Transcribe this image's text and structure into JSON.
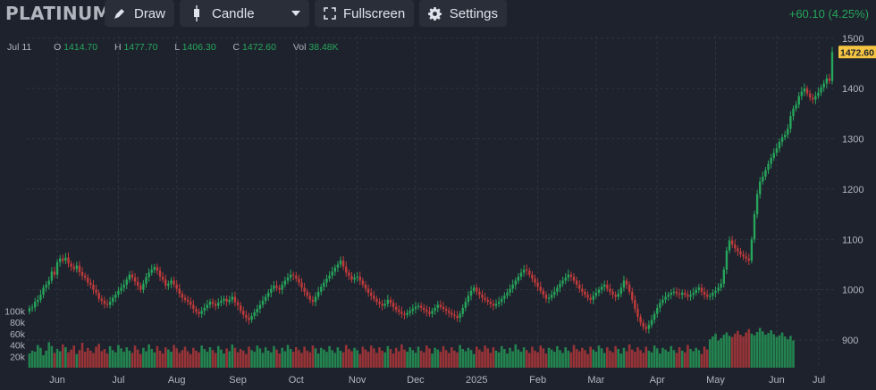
{
  "toolbar": {
    "symbol": "PLATINUM",
    "draw_label": "Draw",
    "chart_type_label": "Candle",
    "fullscreen_label": "Fullscreen",
    "settings_label": "Settings",
    "change_text": "+60.10 (4.25%)"
  },
  "ohlc": {
    "date": "Jul 11",
    "o_label": "O",
    "o": "1414.70",
    "h_label": "H",
    "h": "1477.70",
    "l_label": "L",
    "l": "1406.30",
    "c_label": "C",
    "c": "1472.60",
    "vol_label": "Vol",
    "vol": "38.48K"
  },
  "colors": {
    "up": "#26a65b",
    "down": "#c23b3b",
    "background": "#1e222d",
    "last_price_tag": "#f5c542"
  },
  "chart_data": {
    "type": "candlestick",
    "title": "",
    "xlabel": "",
    "ylabel": "",
    "ylim": [
      845,
      1505
    ],
    "y_ticks": [
      900,
      1000,
      1100,
      1200,
      1300,
      1400,
      1500
    ],
    "x_ticks": [
      "Jun",
      "Jul",
      "Aug",
      "Sep",
      "Oct",
      "Nov",
      "Dec",
      "2025",
      "Feb",
      "Mar",
      "Apr",
      "May",
      "Jun",
      "Jul"
    ],
    "volume_ticks": [
      "100k",
      "80k",
      "60k",
      "40k",
      "20k"
    ],
    "volume_ylim": [
      0,
      110000
    ],
    "last_price": "1472.60",
    "grid": true,
    "closes": [
      963,
      965,
      976,
      980,
      990,
      1004,
      1010,
      1018,
      1036,
      1030,
      1055,
      1062,
      1058,
      1064,
      1052,
      1046,
      1041,
      1048,
      1035,
      1028,
      1024,
      1014,
      1010,
      1000,
      994,
      982,
      978,
      972,
      970,
      976,
      984,
      990,
      998,
      1004,
      1010,
      1020,
      1030,
      1024,
      1016,
      1008,
      1000,
      1012,
      1025,
      1034,
      1040,
      1045,
      1038,
      1026,
      1020,
      1008,
      1012,
      1018,
      1010,
      1002,
      992,
      984,
      980,
      976,
      970,
      962,
      956,
      952,
      958,
      964,
      970,
      976,
      972,
      968,
      974,
      978,
      982,
      976,
      980,
      986,
      975,
      969,
      958,
      950,
      944,
      940,
      948,
      955,
      962,
      970,
      978,
      986,
      994,
      1002,
      1008,
      1004,
      1000,
      1010,
      1018,
      1024,
      1030,
      1028,
      1022,
      1014,
      1004,
      996,
      988,
      980,
      976,
      986,
      996,
      1006,
      1014,
      1022,
      1028,
      1036,
      1044,
      1050,
      1058,
      1046,
      1034,
      1028,
      1020,
      1024,
      1026,
      1018,
      1010,
      1002,
      994,
      988,
      982,
      976,
      972,
      968,
      972,
      980,
      974,
      966,
      960,
      956,
      952,
      950,
      954,
      958,
      962,
      966,
      968,
      964,
      960,
      956,
      952,
      958,
      964,
      970,
      966,
      962,
      958,
      954,
      950,
      948,
      944,
      952,
      964,
      976,
      988,
      998,
      1004,
      996,
      990,
      984,
      980,
      976,
      972,
      968,
      972,
      976,
      982,
      988,
      994,
      1002,
      1010,
      1018,
      1026,
      1034,
      1040,
      1038,
      1030,
      1022,
      1014,
      1006,
      998,
      990,
      982,
      984,
      990,
      996,
      1004,
      1012,
      1018,
      1024,
      1030,
      1026,
      1018,
      1010,
      1002,
      996,
      990,
      984,
      980,
      988,
      994,
      1000,
      1006,
      1010,
      1002,
      996,
      990,
      986,
      992,
      1004,
      1018,
      1010,
      996,
      980,
      962,
      946,
      934,
      926,
      922,
      930,
      940,
      952,
      964,
      974,
      980,
      986,
      990,
      994,
      996,
      992,
      990,
      994,
      990,
      986,
      990,
      994,
      1000,
      1004,
      996,
      990,
      986,
      988,
      994,
      998,
      1004,
      1012,
      1040,
      1078,
      1098,
      1090,
      1082,
      1076,
      1070,
      1066,
      1062,
      1058,
      1100,
      1150,
      1190,
      1215,
      1225,
      1238,
      1250,
      1262,
      1272,
      1281,
      1294,
      1303,
      1308,
      1320,
      1345,
      1360,
      1368,
      1385,
      1394,
      1400,
      1390,
      1382,
      1378,
      1385,
      1392,
      1402,
      1410,
      1420,
      1415,
      1472.6
    ],
    "volumes": [
      25000,
      30000,
      28000,
      40000,
      35000,
      22000,
      30000,
      45000,
      38000,
      26000,
      33000,
      29000,
      41000,
      36000,
      27000,
      32000,
      39000,
      24000,
      31000,
      44000,
      28000,
      35000,
      30000,
      26000,
      37000,
      42000,
      29000,
      33000,
      25000,
      38000,
      31000,
      27000,
      40000,
      34000,
      28000,
      36000,
      30000,
      26000,
      39000,
      32000,
      24000,
      35000,
      29000,
      41000,
      33000,
      27000,
      38000,
      30000,
      25000,
      36000,
      32000,
      28000,
      40000,
      34000,
      26000,
      31000,
      37000,
      29000,
      24000,
      35000,
      30000,
      27000,
      39000,
      33000,
      28000,
      36000,
      31000,
      26000,
      38000,
      32000,
      25000,
      34000,
      29000,
      41000,
      35000,
      27000,
      33000,
      30000,
      24000,
      37000,
      31000,
      28000,
      39000,
      34000,
      26000,
      36000,
      30000,
      27000,
      38000,
      32000,
      25000,
      35000,
      29000,
      40000,
      33000,
      28000,
      36000,
      31000,
      26000,
      37000,
      30000,
      27000,
      39000,
      34000,
      25000,
      35000,
      32000,
      28000,
      38000,
      31000,
      26000,
      36000,
      30000,
      27000,
      40000,
      33000,
      29000,
      35000,
      31000,
      24000,
      37000,
      32000,
      28000,
      39000,
      34000,
      26000,
      36000,
      30000,
      27000,
      38000,
      33000,
      25000,
      35000,
      29000,
      41000,
      32000,
      28000,
      36000,
      31000,
      26000,
      37000,
      30000,
      27000,
      39000,
      34000,
      25000,
      35000,
      32000,
      28000,
      38000,
      31000,
      26000,
      36000,
      30000,
      27000,
      40000,
      33000,
      29000,
      35000,
      31000,
      24000,
      37000,
      32000,
      28000,
      39000,
      34000,
      26000,
      36000,
      30000,
      27000,
      38000,
      33000,
      25000,
      35000,
      29000,
      41000,
      32000,
      28000,
      36000,
      31000,
      26000,
      37000,
      30000,
      27000,
      39000,
      34000,
      25000,
      35000,
      32000,
      28000,
      38000,
      31000,
      26000,
      36000,
      30000,
      27000,
      40000,
      33000,
      29000,
      35000,
      31000,
      24000,
      37000,
      32000,
      28000,
      39000,
      34000,
      26000,
      36000,
      30000,
      27000,
      38000,
      33000,
      25000,
      35000,
      29000,
      41000,
      32000,
      28000,
      36000,
      31000,
      26000,
      37000,
      30000,
      27000,
      39000,
      34000,
      25000,
      35000,
      32000,
      28000,
      38000,
      31000,
      26000,
      36000,
      30000,
      27000,
      40000,
      33000,
      29000,
      35000,
      31000,
      24000,
      37000,
      32000,
      50000,
      55000,
      60000,
      48000,
      52000,
      58000,
      62000,
      56000,
      54000,
      60000,
      65000,
      58000,
      55000,
      62000,
      68000,
      60000,
      57000,
      63000,
      70000,
      64000,
      58000,
      61000,
      66000,
      59000,
      54000,
      57000,
      62000,
      55000,
      50000,
      56000,
      48000
    ]
  }
}
